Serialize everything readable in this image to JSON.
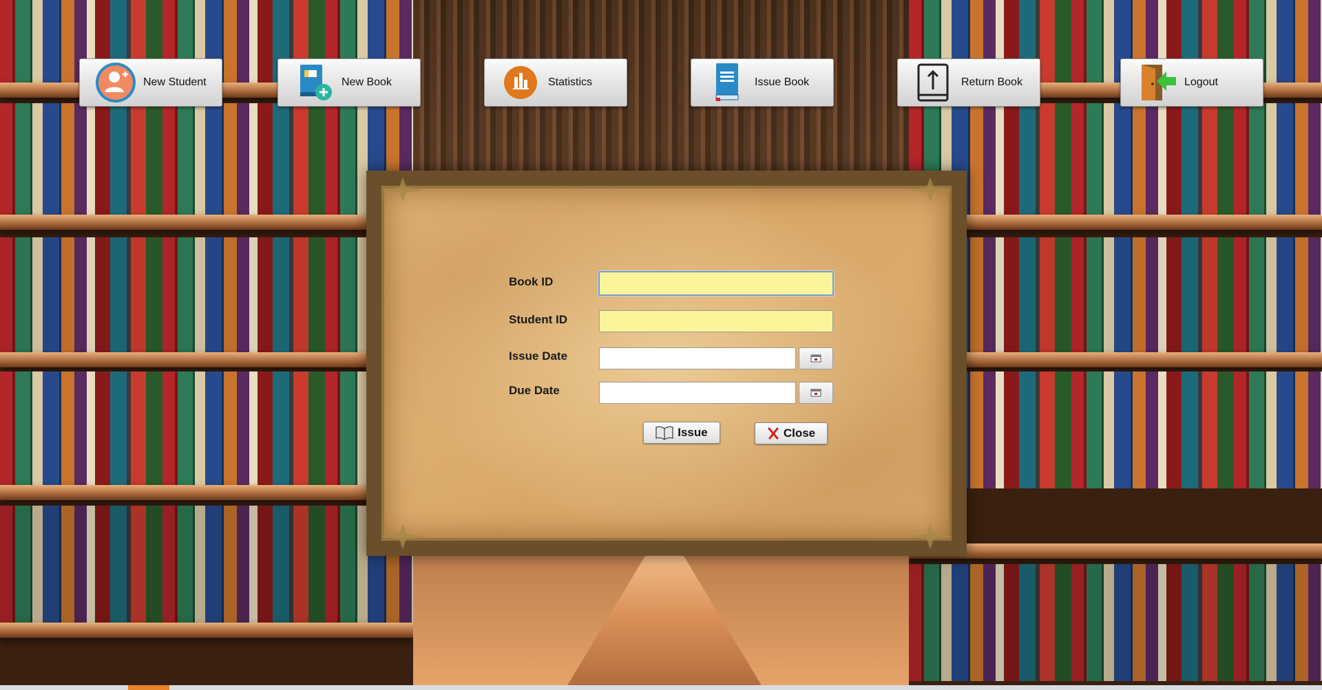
{
  "toolbar": {
    "new_student": {
      "label": "New Student",
      "icon": "add-user-icon"
    },
    "new_book": {
      "label": "New Book",
      "icon": "add-book-icon"
    },
    "statistics": {
      "label": "Statistics",
      "icon": "bar-chart-icon"
    },
    "issue_book": {
      "label": "Issue Book",
      "icon": "book-icon"
    },
    "return_book": {
      "label": "Return Book",
      "icon": "return-book-icon"
    },
    "logout": {
      "label": "Logout",
      "icon": "door-exit-icon"
    }
  },
  "form": {
    "book_id": {
      "label": "Book ID",
      "value": ""
    },
    "student_id": {
      "label": "Student ID",
      "value": ""
    },
    "issue_date": {
      "label": "Issue Date",
      "value": ""
    },
    "due_date": {
      "label": "Due Date",
      "value": ""
    },
    "issue_button": "Issue",
    "close_button": "Close"
  },
  "colors": {
    "input_highlight": "#fbf59a",
    "close_x": "#d42020",
    "accent_orange": "#e8832a",
    "accent_blue": "#2a8ac8"
  }
}
